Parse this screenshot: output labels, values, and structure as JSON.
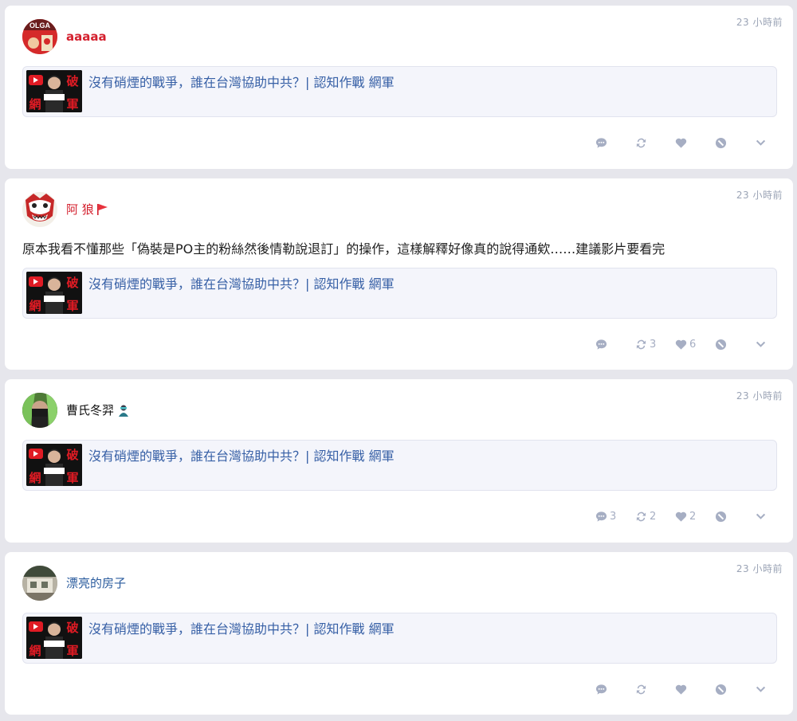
{
  "posts": [
    {
      "user": "aaaaa",
      "timestamp": "23 小時前",
      "avatar_text": "OLGA",
      "text": "",
      "link": {
        "title": "沒有硝煙的戰爭，誰在台灣協助中共？| 認知作戰 網軍",
        "thumb_top": "破",
        "thumb_bottom": "網",
        "thumb_bottom2": "軍"
      },
      "counts": {
        "reply": "",
        "repost": "",
        "like": ""
      }
    },
    {
      "user": "阿 狼",
      "timestamp": "23 小時前",
      "text": "原本我看不懂那些「偽裝是PO主的粉絲然後情勒說退訂」的操作，這樣解釋好像真的說得通欸……建議影片要看完",
      "link": {
        "title": "沒有硝煙的戰爭，誰在台灣協助中共？| 認知作戰 網軍",
        "thumb_top": "破",
        "thumb_bottom": "網",
        "thumb_bottom2": "軍"
      },
      "counts": {
        "reply": "",
        "repost": "3",
        "like": "6"
      }
    },
    {
      "user": "曹氏冬羿",
      "timestamp": "23 小時前",
      "text": "",
      "link": {
        "title": "沒有硝煙的戰爭，誰在台灣協助中共？| 認知作戰 網軍",
        "thumb_top": "破",
        "thumb_bottom": "網",
        "thumb_bottom2": "軍"
      },
      "counts": {
        "reply": "3",
        "repost": "2",
        "like": "2"
      }
    },
    {
      "user": "漂亮的房子",
      "timestamp": "23 小時前",
      "text": "",
      "link": {
        "title": "沒有硝煙的戰爭，誰在台灣協助中共？| 認知作戰 網軍",
        "thumb_top": "破",
        "thumb_bottom": "網",
        "thumb_bottom2": "軍"
      },
      "counts": {
        "reply": "",
        "repost": "",
        "like": ""
      }
    }
  ],
  "icons": {
    "reply": "reply-icon",
    "repost": "repost-icon",
    "like": "heart-icon",
    "block": "block-icon",
    "more": "chevron-down-icon"
  },
  "colors": {
    "name_red": "#d4202e",
    "name_blue": "#2b5c9e",
    "link": "#3760a6",
    "action": "#a6aec3"
  }
}
